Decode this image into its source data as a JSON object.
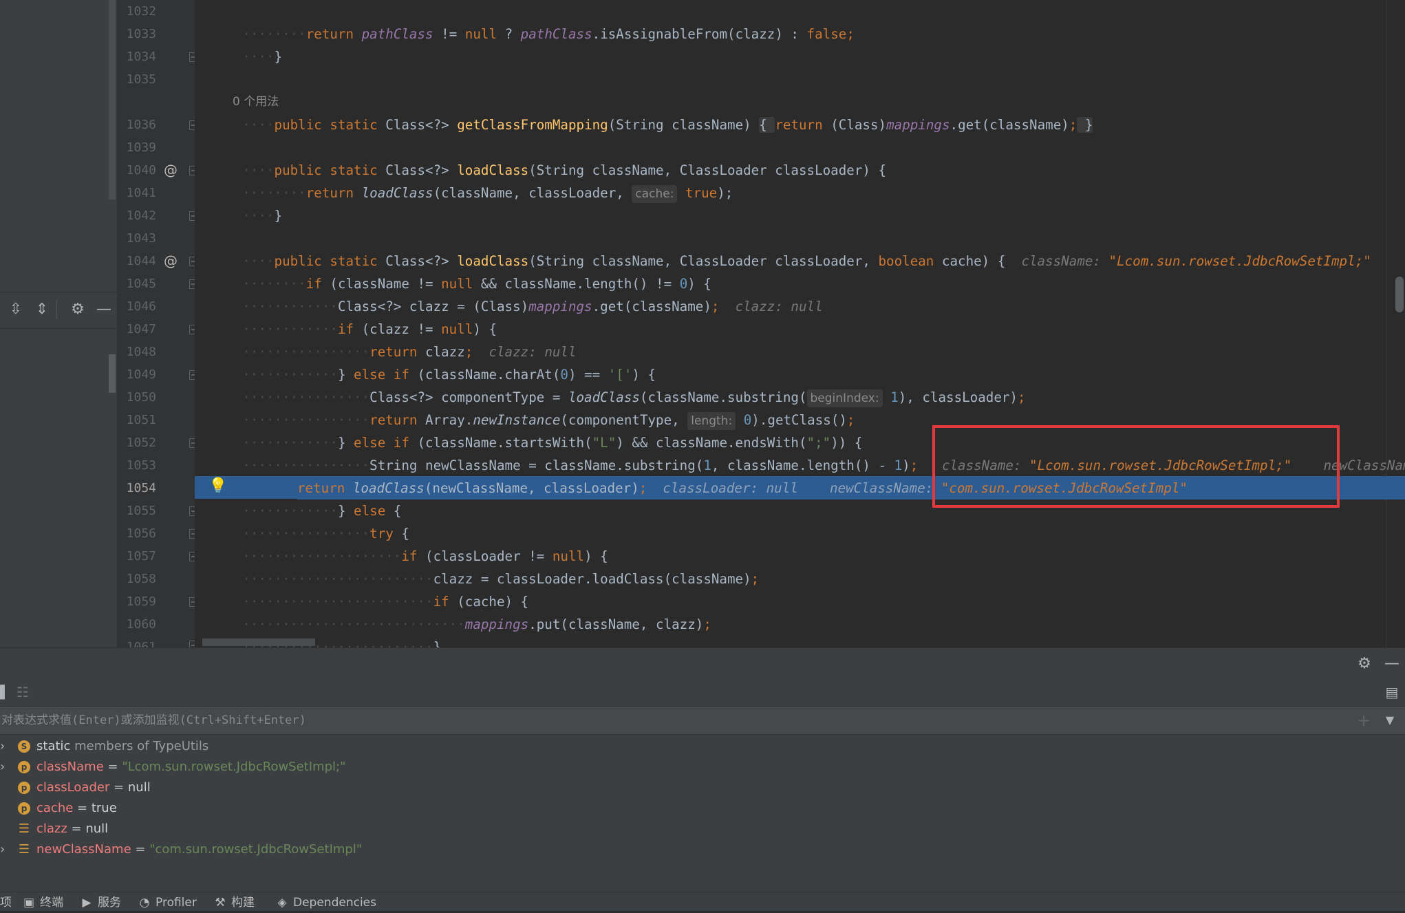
{
  "gutter": {
    "line_numbers": [
      "1032",
      "1033",
      "1034",
      "1035",
      "1036",
      "1039",
      "1040",
      "1041",
      "1042",
      "1043",
      "1044",
      "1045",
      "1046",
      "1047",
      "1048",
      "1049",
      "1050",
      "1051",
      "1052",
      "1053",
      "1054",
      "1055",
      "1056",
      "1057",
      "1058",
      "1059",
      "1060",
      "1061"
    ]
  },
  "code": {
    "usages_label": "0 个用法",
    "l1033": {
      "kw1": "return",
      "fld1": "pathClass",
      "op1": " != ",
      "kw2": "null",
      "op2": " ? ",
      "fld2": "pathClass",
      "rest": ".isAssignableFrom(clazz) : ",
      "kw3": "false",
      "end": ";"
    },
    "l1034": {
      "text": "}"
    },
    "l1036": {
      "kw1": "public static ",
      "type1": "Class<?> ",
      "fn": "getClassFromMapping",
      "params": "(String className) ",
      "fold_open": "{ ",
      "kw2": "return ",
      "cast": "(Class)",
      "fld": "mappings",
      "call": ".get(className)",
      "semi": ";",
      "fold_close": " }"
    },
    "l1040": {
      "kw1": "public static ",
      "type1": "Class<?> ",
      "fn": "loadClass",
      "params": "(String className, ClassLoader classLoader) {"
    },
    "l1041": {
      "kw1": "return ",
      "fn": "loadClass",
      "a1": "(className, classLoader, ",
      "hint": "cache:",
      "kw2": " true",
      "end": ");"
    },
    "l1042": {
      "text": "}"
    },
    "l1044": {
      "kw1": "public static ",
      "type1": "Class<?> ",
      "fn": "loadClass",
      "p1": "(String className, ClassLoader classLoader, ",
      "kw2": "boolean",
      "p2": " cache) {",
      "hint_name": "className: ",
      "hint_val": "\"Lcom.sun.rowset.JdbcRowSetImpl;\""
    },
    "l1045": {
      "kw1": "if",
      "a": " (className != ",
      "kw2": "null",
      "b": " && className.length() != ",
      "num": "0",
      "c": ") {"
    },
    "l1046": {
      "a": "Class<?> clazz = (Class)",
      "fld": "mappings",
      "b": ".get(className)",
      "semi": ";",
      "hint": "clazz: null"
    },
    "l1047": {
      "kw1": "if",
      "a": " (clazz != ",
      "kw2": "null",
      "b": ") {"
    },
    "l1048": {
      "kw1": "return",
      "a": " clazz",
      "semi": ";",
      "hint": "clazz: null"
    },
    "l1049": {
      "a": "} ",
      "kw1": "else if",
      "b": " (className.charAt(",
      "num": "0",
      "c": ") == ",
      "str": "'['",
      "d": ") {"
    },
    "l1050": {
      "a": "Class<?> componentType = ",
      "fn": "loadClass",
      "b": "(className.substring(",
      "hint": "beginIndex:",
      "num": " 1",
      "c": "), classLoader)",
      "semi": ";"
    },
    "l1051": {
      "kw1": "return",
      "a": " Array.",
      "fn": "newInstance",
      "b": "(componentType, ",
      "hint": "length:",
      "num": " 0",
      "c": ").getClass()",
      "semi": ";"
    },
    "l1052": {
      "a": "} ",
      "kw1": "else if",
      "b": " (className.startsWith(",
      "str1": "\"L\"",
      "c": ") && className.endsWith(",
      "str2": "\";\"",
      "d": ")) {"
    },
    "l1053": {
      "a": "String newClassName = className.substring(",
      "num1": "1",
      "b": ", className.length() - ",
      "num2": "1",
      "c": ")",
      "semi": ";",
      "hint1_name": "className: ",
      "hint1_val": "\"Lcom.sun.rowset.JdbcRowSetImpl;\"",
      "hint2_name": "newClassNam"
    },
    "l1054": {
      "kw1": "return ",
      "fn": "loadClass",
      "a": "(newClassName, classLoader)",
      "semi": ";",
      "hint1": "classLoader: null",
      "hint2_name": "newClassName: ",
      "hint2_val": "\"com.sun.rowset.JdbcRowSetImpl\""
    },
    "l1055": {
      "a": "} ",
      "kw1": "else",
      "b": " {"
    },
    "l1056": {
      "kw1": "try",
      "a": " {"
    },
    "l1057": {
      "kw1": "if",
      "a": " (classLoader != ",
      "kw2": "null",
      "b": ") {"
    },
    "l1058": {
      "a": "clazz = classLoader.loadClass(className)",
      "semi": ";"
    },
    "l1059": {
      "kw1": "if",
      "a": " (cache) {"
    },
    "l1060": {
      "fld": "mappings",
      "a": ".put(className, clazz)",
      "semi": ";"
    },
    "l1061": {
      "text": "}"
    }
  },
  "debugger": {
    "eval_placeholder": "对表达式求值(Enter)或添加监视(Ctrl+Shift+Enter)",
    "eval_value": "",
    "variables": [
      {
        "icon": "S",
        "name": "static",
        "rest": " members of TypeUtils",
        "expandable": true
      },
      {
        "icon": "p",
        "name": "className",
        "eq": " = ",
        "value": "\"Lcom.sun.rowset.JdbcRowSetImpl;\"",
        "string": true,
        "expandable": true
      },
      {
        "icon": "p",
        "name": "classLoader",
        "eq": " = ",
        "value": "null",
        "string": false,
        "expandable": false
      },
      {
        "icon": "p",
        "name": "cache",
        "eq": " = ",
        "value": "true",
        "string": false,
        "expandable": false
      },
      {
        "icon": "lines",
        "name": "clazz",
        "eq": " = ",
        "value": "null",
        "string": false,
        "expandable": false
      },
      {
        "icon": "lines",
        "name": "newClassName",
        "eq": " = ",
        "value": "\"com.sun.rowset.JdbcRowSetImpl\"",
        "string": true,
        "expandable": true
      }
    ]
  },
  "status_bar": {
    "items": [
      {
        "icon": "",
        "label": "项"
      },
      {
        "icon": "terminal-icon",
        "label": "终端"
      },
      {
        "icon": "services-icon",
        "label": "服务"
      },
      {
        "icon": "profiler-icon",
        "label": "Profiler"
      },
      {
        "icon": "build-icon",
        "label": "构建"
      },
      {
        "icon": "dependencies-icon",
        "label": "Dependencies"
      }
    ]
  },
  "colors": {
    "accent_selection": "#2d5c93",
    "highlight_box": "#e0393e",
    "keyword": "#cc7832",
    "function": "#ffc66d",
    "field": "#9876aa",
    "number": "#6897bb",
    "string": "#6a8759"
  }
}
